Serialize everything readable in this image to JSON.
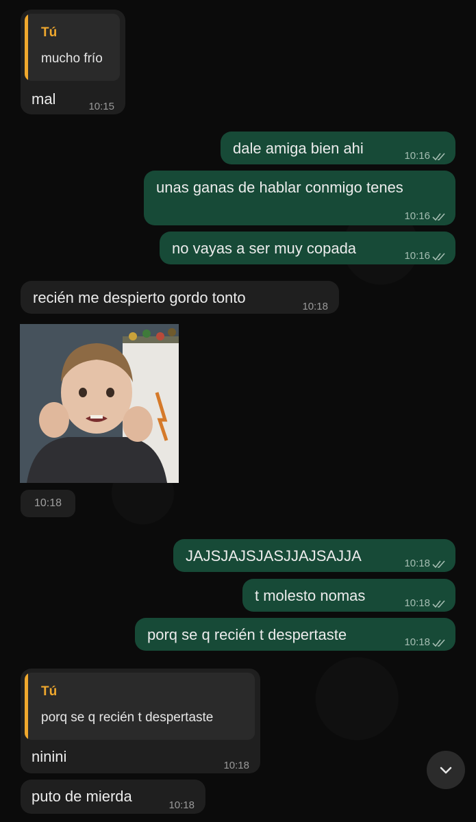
{
  "messages": [
    {
      "reply_author": "Tú",
      "reply_text": "mucho frío",
      "text": "mal",
      "time": "10:15"
    },
    {
      "text": "dale amiga bien ahi",
      "time": "10:16"
    },
    {
      "text": "unas ganas de hablar conmigo tenes",
      "time": "10:16"
    },
    {
      "text": "no vayas a ser muy copada",
      "time": "10:16"
    },
    {
      "text": "recién me despierto gordo tonto",
      "time": "10:18"
    },
    {
      "image": "sticker-boy-clenched-fists",
      "time": "10:18"
    },
    {
      "text": "JAJSJAJSJASJJAJSAJJA",
      "time": "10:18"
    },
    {
      "text": "t molesto nomas",
      "time": "10:18"
    },
    {
      "text": "porq se q recién t despertaste",
      "time": "10:18"
    },
    {
      "reply_author": "Tú",
      "reply_text": "porq se q recién t despertaste",
      "text": "ninini",
      "time": "10:18"
    },
    {
      "text": "puto de mierda",
      "time": "10:18"
    }
  ],
  "colors": {
    "incoming": "#1f1f1f",
    "outgoing": "#174a37",
    "reply_accent": "#f0a82d",
    "background": "#0b0b0b"
  },
  "icons": {
    "read_receipt": "double-check-icon",
    "scroll_down": "chevron-down-icon"
  }
}
